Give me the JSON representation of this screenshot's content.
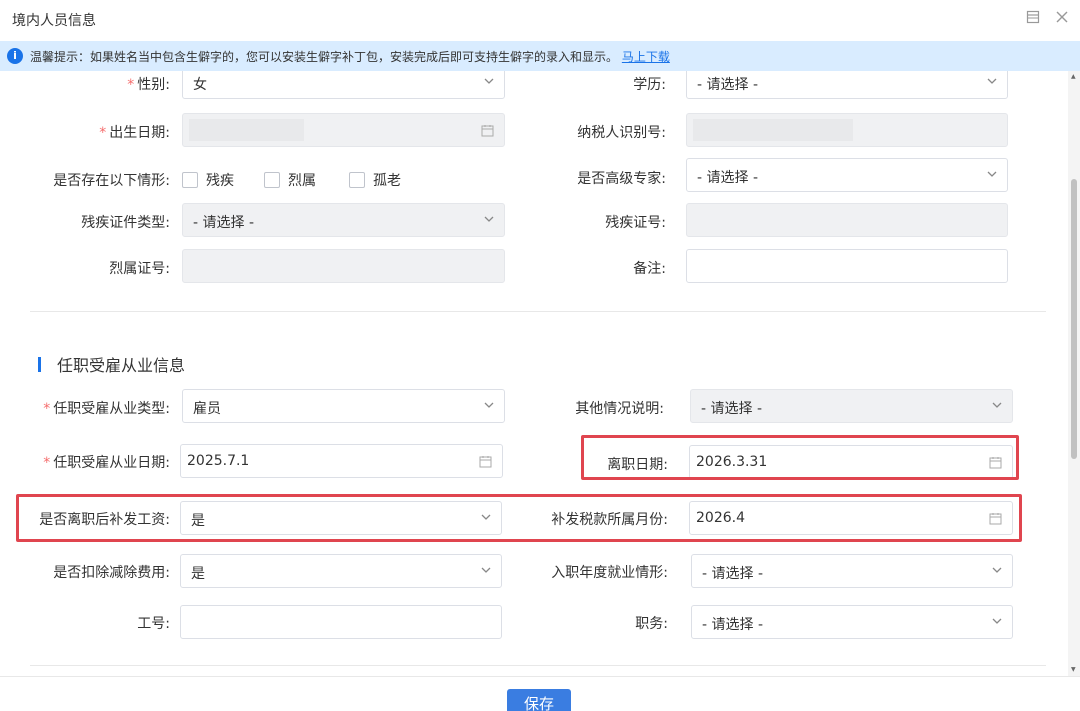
{
  "window": {
    "title": "境内人员信息"
  },
  "notice": {
    "text": "温馨提示：如果姓名当中包含生僻字的，您可以安装生僻字补丁包，安装完成后即可支持生僻字的录入和显示。",
    "link": "马上下载"
  },
  "form": {
    "gender": {
      "label": "性别:",
      "value": "女"
    },
    "education": {
      "label": "学历:",
      "value": "- 请选择 -"
    },
    "birth_date": {
      "label": "出生日期:"
    },
    "taxpayer_id": {
      "label": "纳税人识别号:"
    },
    "situations": {
      "label": "是否存在以下情形:",
      "options": [
        "残疾",
        "烈属",
        "孤老"
      ]
    },
    "senior_expert": {
      "label": "是否高级专家:",
      "value": "- 请选择 -"
    },
    "disability_cert_type": {
      "label": "残疾证件类型:",
      "value": "- 请选择 -"
    },
    "disability_cert_no": {
      "label": "残疾证号:"
    },
    "martyr_cert_no": {
      "label": "烈属证号:"
    },
    "remark": {
      "label": "备注:"
    }
  },
  "employment": {
    "section_title": "任职受雇从业信息",
    "type": {
      "label": "任职受雇从业类型:",
      "value": "雇员"
    },
    "other_notes": {
      "label": "其他情况说明:",
      "value": "- 请选择 -"
    },
    "date": {
      "label": "任职受雇从业日期:",
      "value": "2025.7.1"
    },
    "leave_date": {
      "label": "离职日期:",
      "value": "2026.3.31"
    },
    "back_pay": {
      "label": "是否离职后补发工资:",
      "value": "是"
    },
    "tax_month": {
      "label": "补发税款所属月份:",
      "value": "2026.4"
    },
    "deduct_expense": {
      "label": "是否扣除减除费用:",
      "value": "是"
    },
    "entry_year_situation": {
      "label": "入职年度就业情形:",
      "value": "- 请选择 -"
    },
    "employee_no": {
      "label": "工号:"
    },
    "position": {
      "label": "职务:",
      "value": "- 请选择 -"
    }
  },
  "footer": {
    "save_label": "保存"
  },
  "colors": {
    "accent": "#1a73e8",
    "highlight": "#e0454f",
    "notice_bg": "#d9ecff",
    "required": "#f56c6c"
  },
  "icons": [
    "info-icon",
    "chevron-down-icon",
    "calendar-icon",
    "maximize-icon",
    "close-icon"
  ]
}
